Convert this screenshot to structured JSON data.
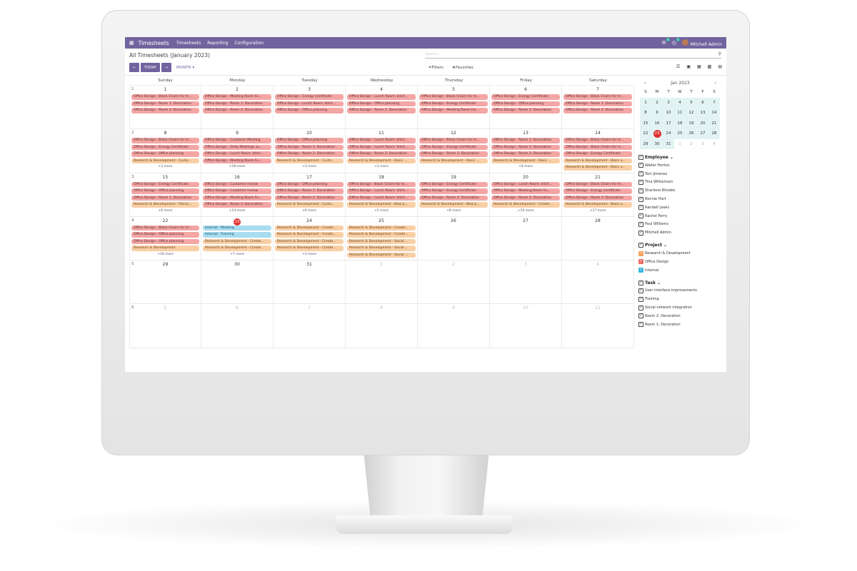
{
  "navbar": {
    "app_name": "Timesheets",
    "menu": [
      "Timesheets",
      "Reporting",
      "Configuration"
    ],
    "chat_count": "3",
    "activity_count": "2",
    "user": "Mitchell Admin"
  },
  "control": {
    "title": "All Timesheets (January 2023)",
    "today_label": "TODAY",
    "scale_label": "MONTH",
    "filters_label": "Filters",
    "favorites_label": "Favorites",
    "search_placeholder": "Search..."
  },
  "weekdays": [
    "Sunday",
    "Monday",
    "Tuesday",
    "Wednesday",
    "Thursday",
    "Friday",
    "Saturday"
  ],
  "weeks": [
    {
      "num": "1",
      "days": [
        {
          "d": "1",
          "ev": [
            [
              "od",
              "Office Design - Black Chairs for m..."
            ],
            [
              "od",
              "Office Design - Room 1: Decoration"
            ],
            [
              "od",
              "Office Design - Room 2: Decoration"
            ]
          ]
        },
        {
          "d": "2",
          "ev": [
            [
              "od",
              "Office Design - Meeting Room Fu..."
            ],
            [
              "od",
              "Office Design - Room 1: Decoration"
            ],
            [
              "od",
              "Office Design - Room 2: Decoration"
            ]
          ]
        },
        {
          "d": "3",
          "ev": [
            [
              "od",
              "Office Design - Energy Certificate"
            ],
            [
              "od",
              "Office Design - Lunch Room: kitch..."
            ],
            [
              "od",
              "Office Design - Office planning"
            ]
          ]
        },
        {
          "d": "4",
          "ev": [
            [
              "od",
              "Office Design - Lunch Room: kitch..."
            ],
            [
              "od",
              "Office Design - Office planning"
            ],
            [
              "od",
              "Office Design - Room 2: Decoration"
            ]
          ]
        },
        {
          "d": "5",
          "ev": [
            [
              "od",
              "Office Design - Black Chairs for m..."
            ],
            [
              "od",
              "Office Design - Energy Certificate"
            ],
            [
              "od",
              "Office Design - Meeting Room Fur..."
            ]
          ]
        },
        {
          "d": "6",
          "ev": [
            [
              "od",
              "Office Design - Energy Certificate"
            ],
            [
              "od",
              "Office Design - Office planning"
            ],
            [
              "od",
              "Office Design - Room 2: Decoration"
            ]
          ]
        },
        {
          "d": "7",
          "ev": [
            [
              "od",
              "Office Design - Black Chairs for m..."
            ],
            [
              "od",
              "Office Design - Room 1: Decoration"
            ],
            [
              "od",
              "Office Design - Room 2: Decoration"
            ]
          ]
        }
      ]
    },
    {
      "num": "2",
      "days": [
        {
          "d": "8",
          "ev": [
            [
              "od",
              "Office Design - Black Chairs for m..."
            ],
            [
              "od",
              "Office Design - Energy Certificate"
            ],
            [
              "od",
              "Office Design - Office planning"
            ],
            [
              "rd",
              "Research & Development - Custo..."
            ]
          ],
          "more": "+2 more"
        },
        {
          "d": "9",
          "ev": [
            [
              "od",
              "Office Design - Customer Meeting"
            ],
            [
              "od",
              "Office Design - Daily Meetings su..."
            ],
            [
              "od",
              "Office Design - Lunch Room: kitch..."
            ],
            [
              "od",
              "Office Design - Meeting Room Fu..."
            ]
          ],
          "more": "+18 more"
        },
        {
          "d": "10",
          "ev": [
            [
              "od",
              "Office Design - Office planning"
            ],
            [
              "od",
              "Office Design - Room 1: Decoration"
            ],
            [
              "od",
              "Office Design - Room 2: Decoration"
            ],
            [
              "rd",
              "Research & Development - Custo..."
            ]
          ],
          "more": "+3 more"
        },
        {
          "d": "11",
          "ev": [
            [
              "od",
              "Office Design - Lunch Room: kitch..."
            ],
            [
              "od",
              "Office Design - Lunch Room: kitch..."
            ],
            [
              "od",
              "Office Design - Room 2: Decoration"
            ],
            [
              "rd",
              "Research & Development - Basic ..."
            ]
          ],
          "more": "+2 more"
        },
        {
          "d": "12",
          "ev": [
            [
              "od",
              "Office Design - Black Chairs for m..."
            ],
            [
              "od",
              "Office Design - Energy Certificate"
            ],
            [
              "od",
              "Office Design - Room 1: Decoration"
            ],
            [
              "rd",
              "Research & Development - Basic ..."
            ]
          ]
        },
        {
          "d": "13",
          "ev": [
            [
              "od",
              "Office Design - Room 1: Decoration"
            ],
            [
              "od",
              "Office Design - Room 2: Decoration"
            ],
            [
              "od",
              "Office Design - Room 2: Decoration"
            ],
            [
              "rd",
              "Research & Development - Basic ..."
            ]
          ],
          "more": "+8 more"
        },
        {
          "d": "14",
          "ev": [
            [
              "od",
              "Office Design - Black Chairs for m..."
            ],
            [
              "od",
              "Office Design - Black Chairs for m..."
            ],
            [
              "od",
              "Office Design - Energy Certificate"
            ],
            [
              "rd",
              "Research & Development - Basic o..."
            ],
            [
              "rd",
              "Research & Development - Basic o..."
            ]
          ]
        }
      ]
    },
    {
      "num": "3",
      "days": [
        {
          "d": "15",
          "ev": [
            [
              "od",
              "Office Design - Energy Certificate"
            ],
            [
              "od",
              "Office Design - Office planning"
            ],
            [
              "od",
              "Office Design - Room 1: Decoration"
            ],
            [
              "rd",
              "Research & Development - Planni..."
            ]
          ],
          "more": "+6 more"
        },
        {
          "d": "16",
          "ev": [
            [
              "od",
              "Office Design - Customer review"
            ],
            [
              "od",
              "Office Design - Customer review"
            ],
            [
              "od",
              "Office Design - Meeting Room Fu..."
            ],
            [
              "od",
              "Office Design - Room 1: Decoration"
            ]
          ],
          "more": "+14 more"
        },
        {
          "d": "17",
          "ev": [
            [
              "od",
              "Office Design - Office planning"
            ],
            [
              "od",
              "Office Design - Room 1: Decoration"
            ],
            [
              "od",
              "Office Design - Room 2: Decoration"
            ],
            [
              "rd",
              "Research & Development - Custo..."
            ]
          ],
          "more": "+6 more"
        },
        {
          "d": "18",
          "ev": [
            [
              "od",
              "Office Design - Black Chairs for m..."
            ],
            [
              "od",
              "Office Design - Lunch Room: kitch..."
            ],
            [
              "od",
              "Office Design - Lunch Room: kitch..."
            ],
            [
              "rd",
              "Research & Development - New p..."
            ]
          ],
          "more": "+5 more"
        },
        {
          "d": "19",
          "ev": [
            [
              "od",
              "Office Design - Energy Certificate"
            ],
            [
              "od",
              "Office Design - Energy Certificate"
            ],
            [
              "od",
              "Office Design - Room 2: Decoration"
            ],
            [
              "rd",
              "Research & Development - New p..."
            ]
          ],
          "more": "+8 more"
        },
        {
          "d": "20",
          "ev": [
            [
              "od",
              "Office Design - Lunch Room: kitch..."
            ],
            [
              "od",
              "Office Design - Meeting Room Fu..."
            ],
            [
              "od",
              "Office Design - Room 2: Decoration"
            ],
            [
              "rd",
              "Research & Development - Create ..."
            ]
          ],
          "more": "+19 more"
        },
        {
          "d": "21",
          "ev": [
            [
              "od",
              "Office Design - Black Chairs for m..."
            ],
            [
              "od",
              "Office Design - Energy Certificate"
            ],
            [
              "od",
              "Office Design - Room 2: Decoration"
            ],
            [
              "rd",
              "Research & Development - Basic o..."
            ]
          ],
          "more": "+17 more"
        }
      ]
    },
    {
      "num": "4",
      "days": [
        {
          "d": "22",
          "ev": [
            [
              "od",
              "Office Design - Black Chairs for m..."
            ],
            [
              "od",
              "Office Design - Office planning"
            ],
            [
              "od",
              "Office Design - Office planning"
            ],
            [
              "rd",
              "Research & Development"
            ]
          ],
          "more": "+18 more"
        },
        {
          "d": "23",
          "today": true,
          "ev": [
            [
              "in",
              "Internal - Meeting"
            ],
            [
              "in",
              "Internal - Training"
            ],
            [
              "rd",
              "Research & Development - Create..."
            ],
            [
              "rd",
              "Research & Development - Create..."
            ]
          ],
          "more": "+7 more"
        },
        {
          "d": "24",
          "ev": [
            [
              "rd",
              "Research & Development - Create..."
            ],
            [
              "rd",
              "Research & Development - Create..."
            ],
            [
              "rd",
              "Research & Development - Create..."
            ],
            [
              "rd",
              "Research & Development - Create..."
            ]
          ],
          "more": "+3 more"
        },
        {
          "d": "25",
          "ev": [
            [
              "rd",
              "Research & Development - Create..."
            ],
            [
              "rd",
              "Research & Development - Create..."
            ],
            [
              "rd",
              "Research & Development - Social ..."
            ],
            [
              "rd",
              "Research & Development - Social ..."
            ],
            [
              "rd",
              "Research & Development - Social ..."
            ]
          ]
        },
        {
          "d": "26",
          "ev": []
        },
        {
          "d": "27",
          "ev": []
        },
        {
          "d": "28",
          "ev": []
        }
      ]
    },
    {
      "num": "5",
      "days": [
        {
          "d": "29",
          "ev": []
        },
        {
          "d": "30",
          "ev": []
        },
        {
          "d": "31",
          "ev": []
        },
        {
          "d": "1",
          "other": true,
          "ev": []
        },
        {
          "d": "2",
          "other": true,
          "ev": []
        },
        {
          "d": "3",
          "other": true,
          "ev": []
        },
        {
          "d": "4",
          "other": true,
          "ev": []
        }
      ]
    },
    {
      "num": "6",
      "days": [
        {
          "d": "5",
          "other": true,
          "ev": []
        },
        {
          "d": "6",
          "other": true,
          "ev": []
        },
        {
          "d": "7",
          "other": true,
          "ev": []
        },
        {
          "d": "8",
          "other": true,
          "ev": []
        },
        {
          "d": "9",
          "other": true,
          "ev": []
        },
        {
          "d": "10",
          "other": true,
          "ev": []
        },
        {
          "d": "11",
          "other": true,
          "ev": []
        }
      ]
    }
  ],
  "mini": {
    "title": "Jan 2023",
    "headers": [
      "S",
      "M",
      "T",
      "W",
      "T",
      "F",
      "S"
    ],
    "days": [
      [
        "1",
        ""
      ],
      [
        "2",
        ""
      ],
      [
        "3",
        ""
      ],
      [
        "4",
        ""
      ],
      [
        "5",
        ""
      ],
      [
        "6",
        ""
      ],
      [
        "7",
        ""
      ],
      [
        "8",
        ""
      ],
      [
        "9",
        ""
      ],
      [
        "10",
        ""
      ],
      [
        "11",
        ""
      ],
      [
        "12",
        ""
      ],
      [
        "13",
        ""
      ],
      [
        "14",
        ""
      ],
      [
        "15",
        ""
      ],
      [
        "16",
        ""
      ],
      [
        "17",
        ""
      ],
      [
        "18",
        ""
      ],
      [
        "19",
        ""
      ],
      [
        "20",
        ""
      ],
      [
        "21",
        ""
      ],
      [
        "22",
        ""
      ],
      [
        "23",
        "today"
      ],
      [
        "24",
        ""
      ],
      [
        "25",
        ""
      ],
      [
        "26",
        ""
      ],
      [
        "27",
        ""
      ],
      [
        "28",
        ""
      ],
      [
        "29",
        ""
      ],
      [
        "30",
        ""
      ],
      [
        "31",
        ""
      ],
      [
        "1",
        "oth"
      ],
      [
        "2",
        "oth"
      ],
      [
        "3",
        "oth"
      ],
      [
        "4",
        "oth"
      ]
    ]
  },
  "filters": {
    "employee": {
      "title": "Employee",
      "items": [
        "Walter Horton",
        "Toni Jimenez",
        "Tina Williamson",
        "Sharlene Rhodes",
        "Ronnie Hart",
        "Randall Lewis",
        "Rachel Perry",
        "Paul Williams",
        "Mitchell Admin"
      ]
    },
    "project": {
      "title": "Project",
      "items": [
        [
          "Research & Development",
          "or"
        ],
        [
          "Office Design",
          "rd"
        ],
        [
          "Internal",
          "bl"
        ]
      ]
    },
    "task": {
      "title": "Task",
      "items": [
        "User interface improvements",
        "Training",
        "Social network integration",
        "Room 2: Decoration",
        "Room 1: Decoration"
      ]
    }
  }
}
